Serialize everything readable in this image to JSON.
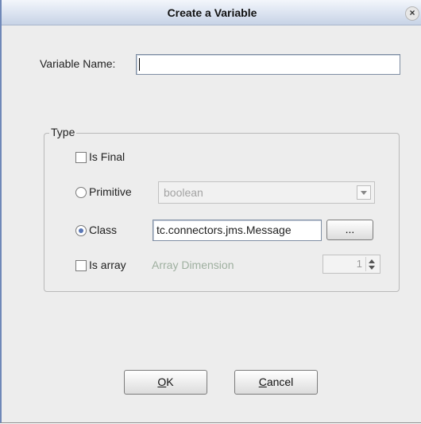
{
  "dialog": {
    "title": "Create a Variable",
    "close_glyph": "×"
  },
  "variable_name": {
    "label": "Variable Name:",
    "value": ""
  },
  "type_group": {
    "label": "Type",
    "is_final": {
      "label": "Is Final",
      "checked": false
    },
    "primitive": {
      "label": "Primitive",
      "selected": false,
      "combo_value": "boolean"
    },
    "class": {
      "label": "Class",
      "selected": true,
      "value": "tc.connectors.jms.Message",
      "browse_label": "..."
    },
    "is_array": {
      "label": "Is array",
      "checked": false,
      "dimension_label": "Array Dimension",
      "dimension_value": "1"
    }
  },
  "buttons": {
    "ok_mnemonic": "O",
    "ok_rest": "K",
    "cancel_mnemonic": "C",
    "cancel_rest": "ancel"
  },
  "icons": {
    "close": "close-icon",
    "dropdown": "chevron-down-icon",
    "spinner_up": "spinner-up-icon",
    "spinner_down": "spinner-down-icon"
  },
  "colors": {
    "title_bar": "#dfe6f2",
    "dialog_bg": "#ededed",
    "radio_selected": "#5a77b5"
  }
}
